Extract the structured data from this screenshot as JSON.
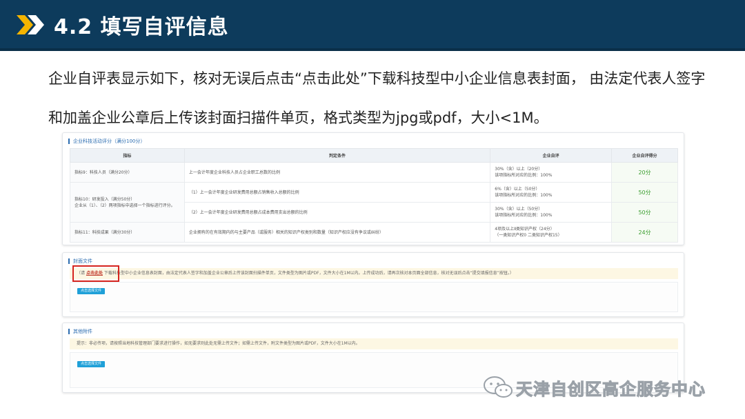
{
  "slide": {
    "title": "4.2 填写自评信息",
    "intro": "企业自评表显示如下，核对无误后点击“点击此处”下载科技型中小企业信息表封面， 由法定代表人签字和加盖企业公章后上传该封面扫描件单页，格式类型为jpg或pdf，大小<1M。",
    "colors": {
      "header": "#0d3b5c",
      "chevron": "#f4b400",
      "highlight": "#d6231e"
    }
  },
  "score_panel": {
    "title": "企业科技活动评分（满分100分）",
    "headers": [
      "指标",
      "判定条件",
      "企业自评",
      "企业自评得分"
    ],
    "rows": [
      {
        "indicator": "指标9：科技人员（满分20分）",
        "condition": "上一会计年度企业科技人员占企业职工总数的比例",
        "self_eval": "30%（含）以上（20分）\n该项指标所对应的比例：100%",
        "score": "20分"
      },
      {
        "indicator": "指标10：研发投入（满分50分）\n企业从（1）、（2）两项指标中选择一个指标进行评分。",
        "condition": "（1）上一会计年度企业研发费用总额占销售收入总额的比例",
        "self_eval": "6%（含）以上（50分）\n该项指标所对应的比例：100%",
        "score": "50分"
      },
      {
        "indicator": "",
        "condition": "（2）上一会计年度企业研发费用总额占成本费用支出总额的比例",
        "self_eval": "30%（含）以上（50分）\n该项指标所对应的比例：100%",
        "score": "50分"
      },
      {
        "indicator": "指标11：科技成果（满分30分）",
        "condition": "企业拥有的在有效期内的与主要产品（或服务）相关的知识产权类别和数量（知识产权应没有争议或纠纷）",
        "self_eval": "4项及以上Ⅱ类知识产权（24分）\n（一类知识产权0 二类知识产权15）",
        "score": "24分"
      }
    ]
  },
  "cover_panel": {
    "title": "封面文件",
    "notice_prefix": "（请",
    "notice_link": "点击此处",
    "notice_suffix": "下载科技型中小企业信息表封面，由法定代表人签字和加盖企业公章后上传该封面扫描件单页，文件类型为图片或PDF，文件大小在1M以内。上传成功后，请再次核对本页面全部信息，核对无误后点击“提交填报信息”按钮。）",
    "upload_label": "点击选择文件"
  },
  "attachment_panel": {
    "title": "其他附件",
    "notice": "提示：非必传项，请按照当地科技管理部门要求进行操作，如无要求则此处无需上传文件；如需上传文件，附文件类型为图片或PDF，文件大小在1M以内。",
    "upload_label": "点击选择文件"
  },
  "watermark": {
    "text": "天津自创区高企服务中心",
    "icon": "wechat-icon"
  }
}
